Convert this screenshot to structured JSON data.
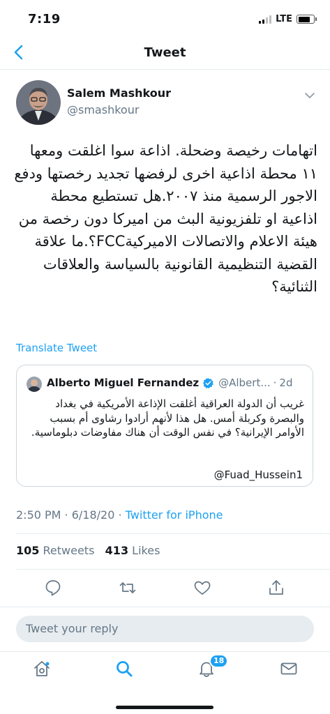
{
  "status": {
    "time": "7:19",
    "network": "LTE"
  },
  "nav": {
    "title": "Tweet"
  },
  "tweet": {
    "author_name": "Salem Mashkour",
    "handle": "@smashkour",
    "text": "اتهامات رخيصة وضحلة. اذاعة سوا اغلقت ومعها ١١ محطة اذاعية اخرى لرفضها تجديد رخصتها ودفع الاجور الرسمية منذ ٢٠٠٧.هل تستطيع محطة اذاعية او تلفزيونية البث من اميركا دون رخصة من هيئة الاعلام والاتصالات الاميركيةFCC؟.ما علاقة القضية التنظيمية القانونية بالسياسة والعلاقات الثنائية؟",
    "translate_label": "Translate Tweet",
    "timestamp": "2:50 PM · 6/18/20 · ",
    "source": "Twitter for iPhone",
    "retweets_count": "105",
    "retweets_label": "Retweets",
    "likes_count": "413",
    "likes_label": "Likes"
  },
  "quoted": {
    "author_name": "Alberto Miguel Fernandez",
    "handle": "@Albert...",
    "separator": "·",
    "time": "2d",
    "text": "غريب أن الدولة العراقية أغلقت الإذاعة الأمريكية في بغداد والبصرة وكربلة أمس. هل هذا لأنهم أرادوا رشاوى أم بسبب الأوامر الإيرانية؟ في نفس الوقت أن هناك مفاوضات دبلوماسية.",
    "mention": "@Fuad_Hussein1"
  },
  "reply": {
    "placeholder": "Tweet your reply"
  },
  "tabbar": {
    "notifications_badge": "18"
  },
  "colors": {
    "accent": "#1da1f2",
    "secondary_text": "#657786",
    "divider": "#e6ecf0"
  }
}
